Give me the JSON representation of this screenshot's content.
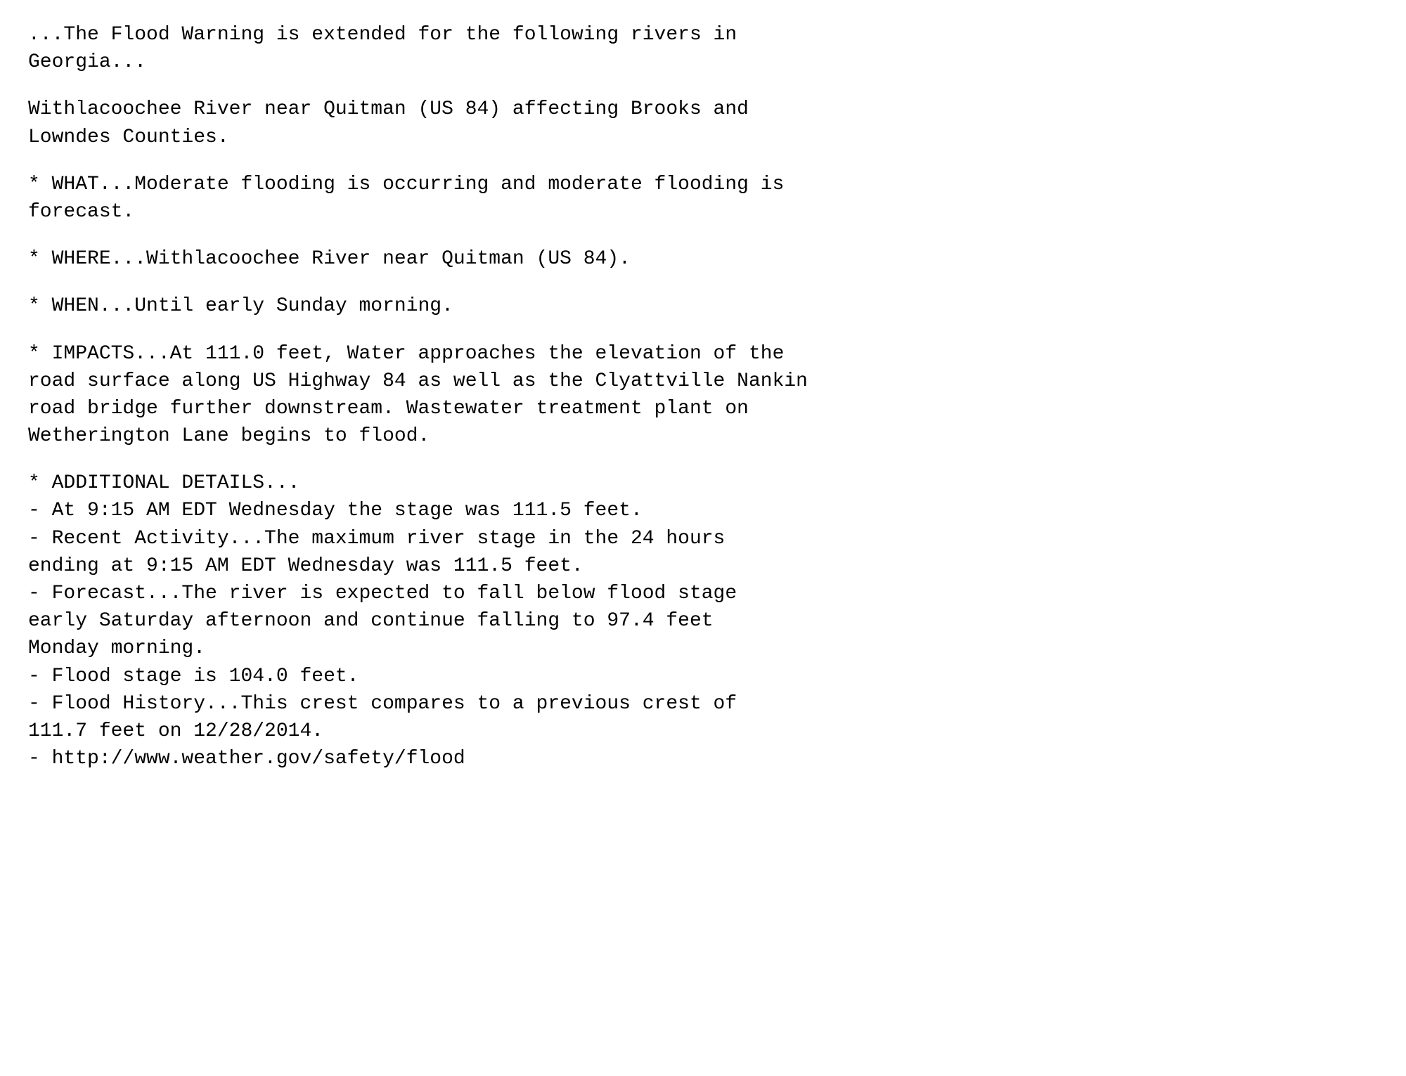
{
  "content": {
    "intro": "...The Flood Warning is extended for the following rivers in\nGeorgia...",
    "location": "Withlacoochee River near Quitman (US 84) affecting Brooks and\nLowndes Counties.",
    "what": "* WHAT...Moderate flooding is occurring and moderate flooding is\nforecast.",
    "where": "* WHERE...Withlacoochee River near Quitman (US 84).",
    "when": "* WHEN...Until early Sunday morning.",
    "impacts": "* IMPACTS...At 111.0 feet, Water approaches the elevation of the\nroad surface along US Highway 84 as well as the Clyattville Nankin\nroad bridge further downstream. Wastewater treatment plant on\nWetherington Lane begins to flood.",
    "additional_header": "* ADDITIONAL DETAILS...",
    "detail1": "- At 9:15 AM EDT Wednesday the stage was 111.5 feet.",
    "detail2": "- Recent Activity...The maximum river stage in the 24 hours\nending at 9:15 AM EDT Wednesday was 111.5 feet.",
    "detail3": "- Forecast...The river is expected to fall below flood stage\nearly Saturday afternoon and continue falling to 97.4 feet\nMonday morning.",
    "detail4": "- Flood stage is 104.0 feet.",
    "detail5": "- Flood History...This crest compares to a previous crest of\n111.7 feet on 12/28/2014.",
    "detail6": "- http://www.weather.gov/safety/flood"
  }
}
